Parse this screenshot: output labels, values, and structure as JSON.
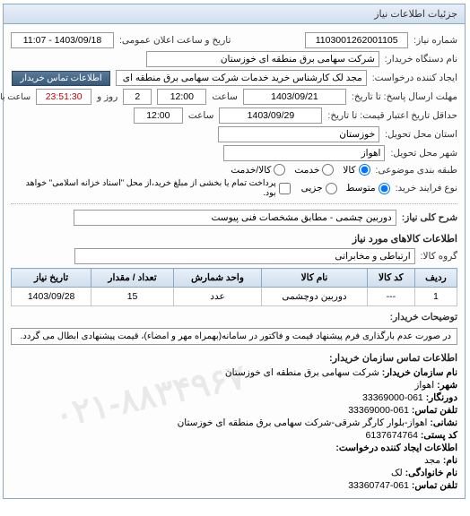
{
  "panel_title": "جزئیات اطلاعات نیاز",
  "fields": {
    "req_no_label": "شماره نیاز:",
    "req_no": "1103001262001105",
    "pub_date_label": "تاریخ و ساعت اعلان عمومی:",
    "pub_date": "1403/09/18 - 11:07",
    "buyer_org_label": "نام دستگاه خریدار:",
    "buyer_org": "شرکت سهامی برق منطقه ای خوزستان",
    "creator_label": "ایجاد کننده درخواست:",
    "creator": "مجد لک کارشناس خرید خدمات شرکت سهامی برق منطقه ای خوزستان",
    "contact_btn": "اطلاعات تماس خریدار",
    "deadline_label": "مهلت ارسال پاسخ: تا تاریخ:",
    "deadline_date": "1403/09/21",
    "time_label": "ساعت",
    "deadline_time": "12:00",
    "days": "2",
    "days_suffix": "روز و",
    "remaining": "23:51:30",
    "remaining_label": "ساعت باقی مانده",
    "quote_valid_label": "حداقل تاریخ اعتبار قیمت: تا تاریخ:",
    "quote_valid_date": "1403/09/29",
    "quote_valid_time": "12:00",
    "province_label": "استان محل تحویل:",
    "province": "خوزستان",
    "city_label": "شهر محل تحویل:",
    "city": "اهواز",
    "class_label": "طبقه بندی موضوعی:",
    "class_kala": "کالا",
    "class_khadmat": "خدمت",
    "class_both": "کالا/خدمت",
    "process_label": "نوع فرایند خرید:",
    "process_mid": "متوسط",
    "process_small": "جزیی",
    "process_note": "پرداخت تمام یا بخشی از مبلغ خرید،از محل \"اسناد خزانه اسلامی\" خواهد بود.",
    "overall_label": "شرح کلی نیاز:",
    "overall": "دوربین چشمی - مطابق مشخصات فنی پیوست",
    "goods_info_title": "اطلاعات کالاهای مورد نیاز",
    "group_label": "گروه کالا:",
    "group": "ارتباطی و مخابراتی"
  },
  "table": {
    "headers": [
      "ردیف",
      "کد کالا",
      "نام کالا",
      "واحد شمارش",
      "تعداد / مقدار",
      "تاریخ نیاز"
    ],
    "rows": [
      {
        "idx": "1",
        "code": "---",
        "name": "دوربین دوچشمی",
        "unit": "عدد",
        "qty": "15",
        "date": "1403/09/28"
      }
    ]
  },
  "buyer_note_label": "توضیحات خریدار:",
  "buyer_note": "در صورت عدم بارگذاری فرم پیشنهاد قیمت و فاکتور در سامانه(بهمراه مهر و امضاء)، قیمت پیشنهادی ابطال می گردد.",
  "contact_title": "اطلاعات تماس سازمان خریدار:",
  "contact": {
    "org_name_label": "نام سازمان خریدار:",
    "org_name": "شرکت سهامی برق منطقه ای خوزستان",
    "city_label": "شهر:",
    "city": "اهواز",
    "fax_label": "دورنگار:",
    "fax": "061-33369000",
    "phone_label": "تلفن تماس:",
    "phone": "061-33369000",
    "address_label": "نشانی:",
    "address": "اهواز-بلوار کارگر شرقی-شرکت سهامی برق منطقه ای خوزستان",
    "postal_label": "کد پستی:",
    "postal": "6137674764",
    "req_creator_title": "اطلاعات ایجاد کننده درخواست:",
    "fname_label": "نام:",
    "fname": "مجد",
    "lname_label": "نام خانوادگی:",
    "lname": "لک",
    "cphone_label": "تلفن تماس:",
    "cphone": "061-33360747"
  },
  "watermark": "۰۲۱-۸۸۳۴۹۶۷"
}
